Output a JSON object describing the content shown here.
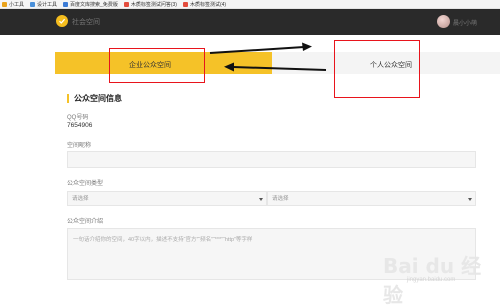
{
  "bookmarks": [
    {
      "label": "小工具",
      "color": "#e9a21a"
    },
    {
      "label": "设计工具",
      "color": "#4a90d9"
    },
    {
      "label": "百度文库搜索_免费版",
      "color": "#3b7bd5"
    },
    {
      "label": "木质标签测试问答(3)",
      "color": "#e34c3c"
    },
    {
      "label": "木质标签测试(4)",
      "color": "#e34c3c"
    }
  ],
  "header": {
    "logo_text": "社会空间",
    "user_name": "晨小小萌"
  },
  "tabs": {
    "company": "企业公众空间",
    "personal": "个人公众空间"
  },
  "section": {
    "title": "公众空间信息"
  },
  "form": {
    "qq_label": "QQ号码",
    "qq_value": "7654906",
    "name_label": "空间昵称",
    "type_label": "公众空间类型",
    "type_select1": "请选择",
    "type_select2": "请选择",
    "intro_label": "公众空间介绍",
    "intro_placeholder": "一句话介绍你的空间，40字以内，描述不支持“官方”“频名”“***”“http”等字样"
  },
  "watermark": {
    "main": "Bai du 经验",
    "sub": "jingyan.baidu.com"
  },
  "colors": {
    "accent": "#f5c228",
    "annotation_red": "#e8141c",
    "topbar": "#2a2a2a"
  }
}
